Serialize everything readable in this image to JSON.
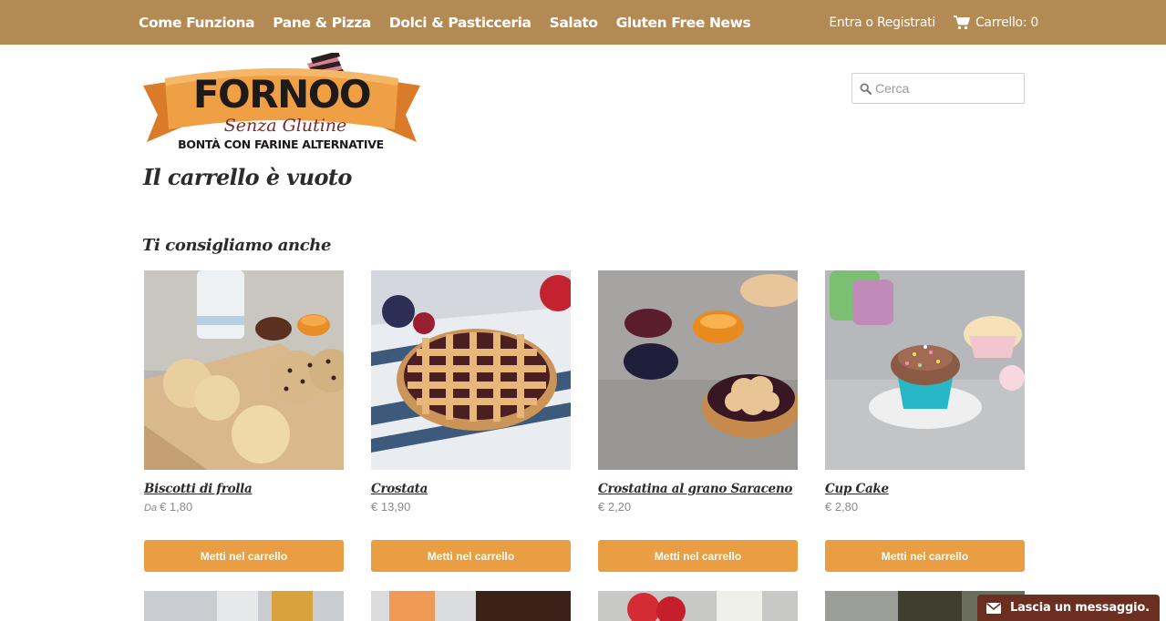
{
  "nav": {
    "items": [
      {
        "label": "Come Funziona"
      },
      {
        "label": "Pane & Pizza"
      },
      {
        "label": "Dolci & Pasticceria"
      },
      {
        "label": "Salato"
      },
      {
        "label": "Gluten Free News"
      }
    ],
    "login_label": "Entra o Registrati",
    "cart_label": "Carrello: 0",
    "cart_icon": "shopping-cart-icon"
  },
  "logo": {
    "brand": "FORNOO",
    "script_line": "Senza Glutine",
    "tagline": "BONTÀ CON FARINE ALTERNATIVE"
  },
  "search": {
    "placeholder": "Cerca",
    "value": "",
    "icon": "search-icon"
  },
  "cart": {
    "empty_title": "Il carrello è vuoto"
  },
  "recommendations": {
    "title": "Ti consigliamo anche",
    "products": [
      {
        "name": "Biscotti di frolla",
        "price_prefix": "Da",
        "price": "€ 1,80",
        "button": "Metti nel carrello"
      },
      {
        "name": "Crostata",
        "price_prefix": "",
        "price": "€ 13,90",
        "button": "Metti nel carrello"
      },
      {
        "name": "Crostatina al grano Saraceno",
        "price_prefix": "",
        "price": "€ 2,20",
        "button": "Metti nel carrello"
      },
      {
        "name": "Cup Cake",
        "price_prefix": "",
        "price": "€ 2,80",
        "button": "Metti nel carrello"
      }
    ]
  },
  "chat": {
    "label": "Lascia un messaggio.",
    "icon": "envelope-icon"
  },
  "colors": {
    "nav_bg": "#b48a54",
    "button": "#e99e43",
    "chat_bg": "#6b2f22",
    "logo_ribbon": "#e8953c"
  }
}
